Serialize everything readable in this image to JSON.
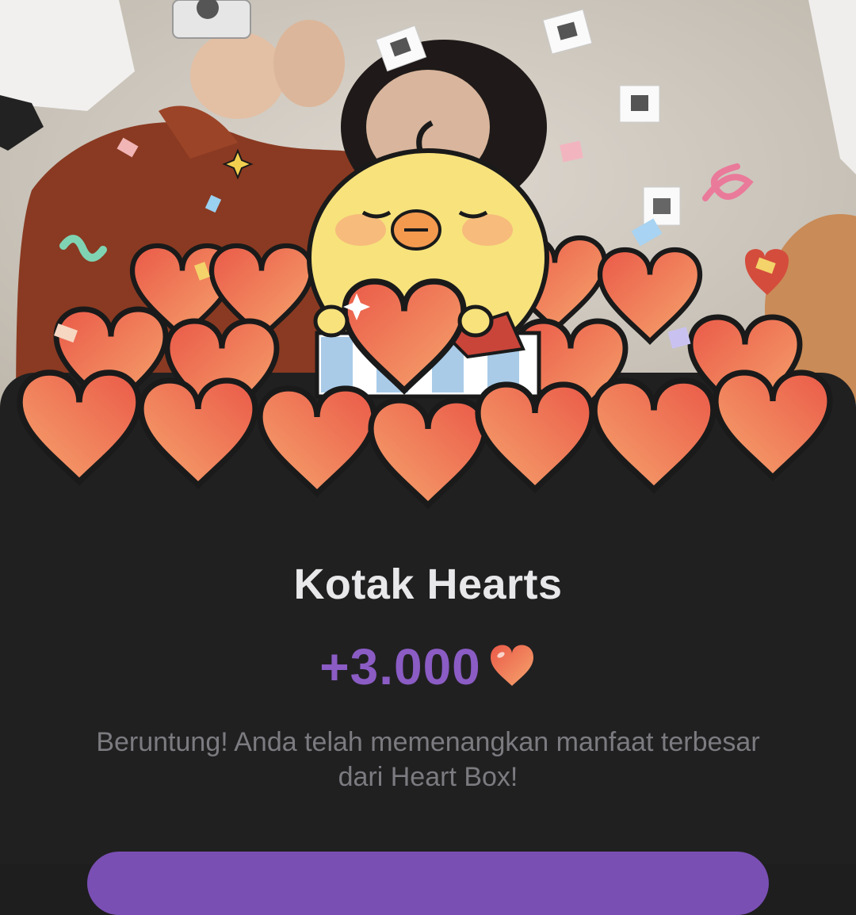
{
  "reward": {
    "title": "Kotak Hearts",
    "amount": "+3.000",
    "description": "Beruntung! Anda telah memenangkan manfaat terbesar dari Heart Box!"
  },
  "colors": {
    "sheet_bg": "#202021",
    "title": "#e8e8ea",
    "amount": "#8b5cc4",
    "description": "#7b7b80",
    "heart_light": "#f6a56e",
    "heart_dark": "#ea5a48",
    "chick": "#f7e27c"
  },
  "icons": [
    "heart-icon",
    "chick-mascot",
    "heart-box-illustration",
    "confetti"
  ]
}
